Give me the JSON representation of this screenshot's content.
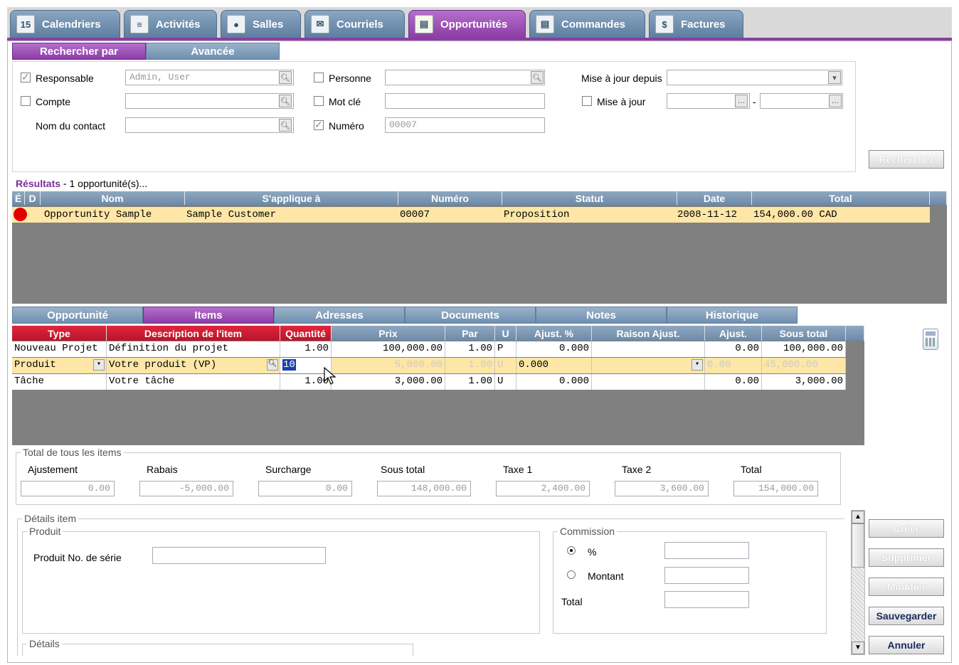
{
  "tabs": [
    {
      "label": "Calendriers",
      "icon": "calendar-icon",
      "glyph": "15"
    },
    {
      "label": "Activités",
      "icon": "activities-icon",
      "glyph": "≡"
    },
    {
      "label": "Salles",
      "icon": "rooms-icon",
      "glyph": "●"
    },
    {
      "label": "Courriels",
      "icon": "email-icon",
      "glyph": "✉"
    },
    {
      "label": "Opportunités",
      "icon": "opportunities-icon",
      "glyph": "▤"
    },
    {
      "label": "Commandes",
      "icon": "orders-icon",
      "glyph": "▤"
    },
    {
      "label": "Factures",
      "icon": "invoices-icon",
      "glyph": "$"
    }
  ],
  "search_tabs": {
    "basic": "Rechercher par",
    "advanced": "Avancée"
  },
  "search": {
    "responsable_label": "Responsable",
    "responsable_value": "Admin, User",
    "compte_label": "Compte",
    "compte_value": "",
    "nom_contact_label": "Nom du contact",
    "nom_contact_value": "",
    "personne_label": "Personne",
    "personne_value": "",
    "mot_cle_label": "Mot clé",
    "mot_cle_value": "",
    "numero_label": "Numéro",
    "numero_value": "00007",
    "maj_depuis_label": "Mise à jour depuis",
    "maj_depuis_value": "",
    "maj_label": "Mise à jour",
    "maj_from": "",
    "maj_to": "",
    "range_sep": "-",
    "search_button": "Rechercher"
  },
  "results": {
    "title": "Résultats",
    "sep": " - ",
    "count": "1",
    "suffix": "opportunité(s)...",
    "headers": [
      "É",
      "D",
      "Nom",
      "S'applique à",
      "Numéro",
      "Statut",
      "Date",
      "Total"
    ],
    "rows": [
      {
        "status_color": "#e00000",
        "nom": "Opportunity Sample",
        "applique": "Sample Customer",
        "numero": "00007",
        "statut": "Proposition",
        "date": "2008-11-12",
        "total": "154,000.00 CAD"
      }
    ]
  },
  "detail_tabs": [
    "Opportunité",
    "Items",
    "Adresses",
    "Documents",
    "Notes",
    "Historique"
  ],
  "items": {
    "headers": [
      "Type",
      "Description de l'item",
      "Quantité",
      "Prix",
      "Par",
      "U",
      "Ajust. %",
      "Raison Ajust.",
      "Ajust.",
      "Sous total"
    ],
    "rows": [
      {
        "type": "Nouveau Projet",
        "desc": "Définition du projet",
        "qty": "1.00",
        "prix": "100,000.00",
        "par": "1.00",
        "u": "P",
        "ajust_pct": "0.000",
        "raison": "",
        "ajust": "0.00",
        "sous_total": "100,000.00"
      },
      {
        "type": "Produit",
        "desc": "Votre produit (VP)",
        "qty": "10",
        "prix": "5,000.00",
        "par": "1.00",
        "u": "U",
        "ajust_pct": "0.000",
        "raison": "",
        "ajust": "0.00",
        "sous_total": "45,000.00"
      },
      {
        "type": "Tâche",
        "desc": "Votre tâche",
        "qty": "1.00",
        "prix": "3,000.00",
        "par": "1.00",
        "u": "U",
        "ajust_pct": "0.000",
        "raison": "",
        "ajust": "0.00",
        "sous_total": "3,000.00"
      }
    ]
  },
  "totals": {
    "legend": "Total de tous les items",
    "labels": [
      "Ajustement",
      "Rabais",
      "Surcharge",
      "Sous total",
      "Taxe 1",
      "Taxe 2",
      "Total"
    ],
    "values": [
      "0.00",
      "-5,000.00",
      "0.00",
      "148,000.00",
      "2,400.00",
      "3,600.00",
      "154,000.00"
    ]
  },
  "details": {
    "legend": "Détails item",
    "produit_legend": "Produit",
    "serial_label": "Produit No. de série",
    "serial_value": "",
    "commission_legend": "Commission",
    "percent_label": "%",
    "montant_label": "Montant",
    "total_label": "Total",
    "details_legend": "Détails"
  },
  "actions": {
    "create": "Créer",
    "delete": "Supprimer",
    "modify": "Modifier",
    "save": "Sauvegarder",
    "cancel": "Annuler"
  },
  "colors": {
    "accent": "#8b3da6",
    "header_blue": "#6c8aa8",
    "header_red": "#c81a30",
    "selected_row": "#fde6a6"
  }
}
